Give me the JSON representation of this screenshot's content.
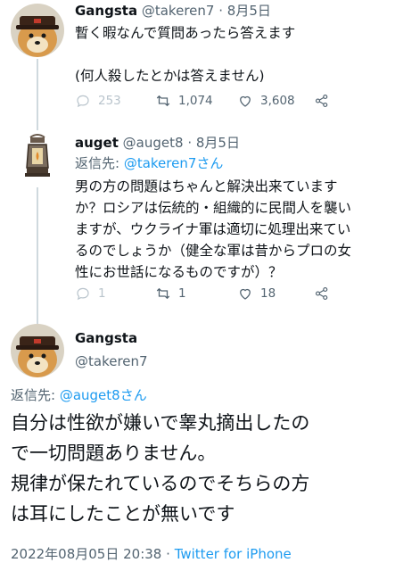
{
  "tweet1": {
    "display_name": "Gangsta",
    "handle": "@takeren7",
    "separator": "·",
    "date": "8月5日",
    "text_lines": [
      "暫く暇なんで質問あったら答えます",
      "",
      "(何人殺したとかは答えません)"
    ],
    "actions": {
      "reply_count": "253",
      "retweet_count": "1,074",
      "like_count": "3,608"
    }
  },
  "tweet2": {
    "display_name": "auget",
    "handle": "@auget8",
    "separator": "·",
    "date": "8月5日",
    "reply_to_prefix": "返信先: ",
    "reply_to_handle": "@takeren7さん",
    "text_lines": [
      "男の方の問題はちゃんと解決出来ています",
      "か？ロシアは伝統的・組織的に民間人を襲い",
      "ますが、ウクライナ軍は適切に処理出来てい",
      "るのでしょうか（健全な軍は昔からプロの女",
      "性にお世話になるものですが）？"
    ],
    "actions": {
      "reply_count": "1",
      "retweet_count": "1",
      "like_count": "18"
    }
  },
  "tweet3": {
    "display_name": "Gangsta",
    "handle": "@takeren7",
    "reply_to_prefix": "返信先: ",
    "reply_to_handle": "@auget8さん",
    "text_lines": [
      "自分は性欲が嫌いで睾丸摘出したの",
      "で一切問題ありません。",
      "規律が保たれているのでそちらの方",
      "は耳にしたことが無いです"
    ],
    "timestamp": "2022年08月05日 20:38",
    "meta_separator": "·",
    "source": "Twitter for iPhone"
  },
  "icons": [
    "reply-icon",
    "retweet-icon",
    "like-icon",
    "share-icon"
  ],
  "colors": {
    "link": "#1d9bf0",
    "secondary": "#536471",
    "line": "#cfd9de"
  }
}
